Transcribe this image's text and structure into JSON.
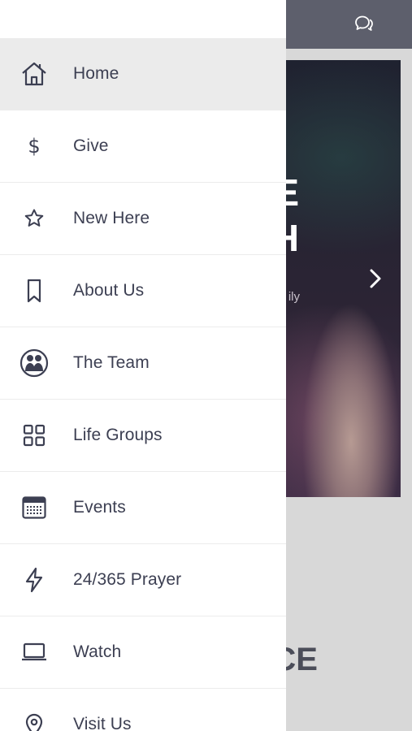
{
  "app": {
    "hero": {
      "line1": "E",
      "line2": "H",
      "subtitle": "ily"
    },
    "section_title": "CE"
  },
  "drawer": {
    "items": [
      {
        "label": "Home",
        "icon": "home-icon",
        "active": true
      },
      {
        "label": "Give",
        "icon": "dollar-icon",
        "active": false
      },
      {
        "label": "New Here",
        "icon": "star-icon",
        "active": false
      },
      {
        "label": "About Us",
        "icon": "bookmark-icon",
        "active": false
      },
      {
        "label": "The Team",
        "icon": "team-icon",
        "active": false
      },
      {
        "label": "Life Groups",
        "icon": "grid-icon",
        "active": false
      },
      {
        "label": "Events",
        "icon": "calendar-icon",
        "active": false
      },
      {
        "label": "24/365 Prayer",
        "icon": "bolt-icon",
        "active": false
      },
      {
        "label": "Watch",
        "icon": "laptop-icon",
        "active": false
      },
      {
        "label": "Visit Us",
        "icon": "location-pin-icon",
        "active": false
      }
    ]
  },
  "colors": {
    "header": "#5d5f6c",
    "drawer_bg": "#ffffff",
    "active_item_bg": "#ebebeb",
    "text": "#3c3f52"
  }
}
